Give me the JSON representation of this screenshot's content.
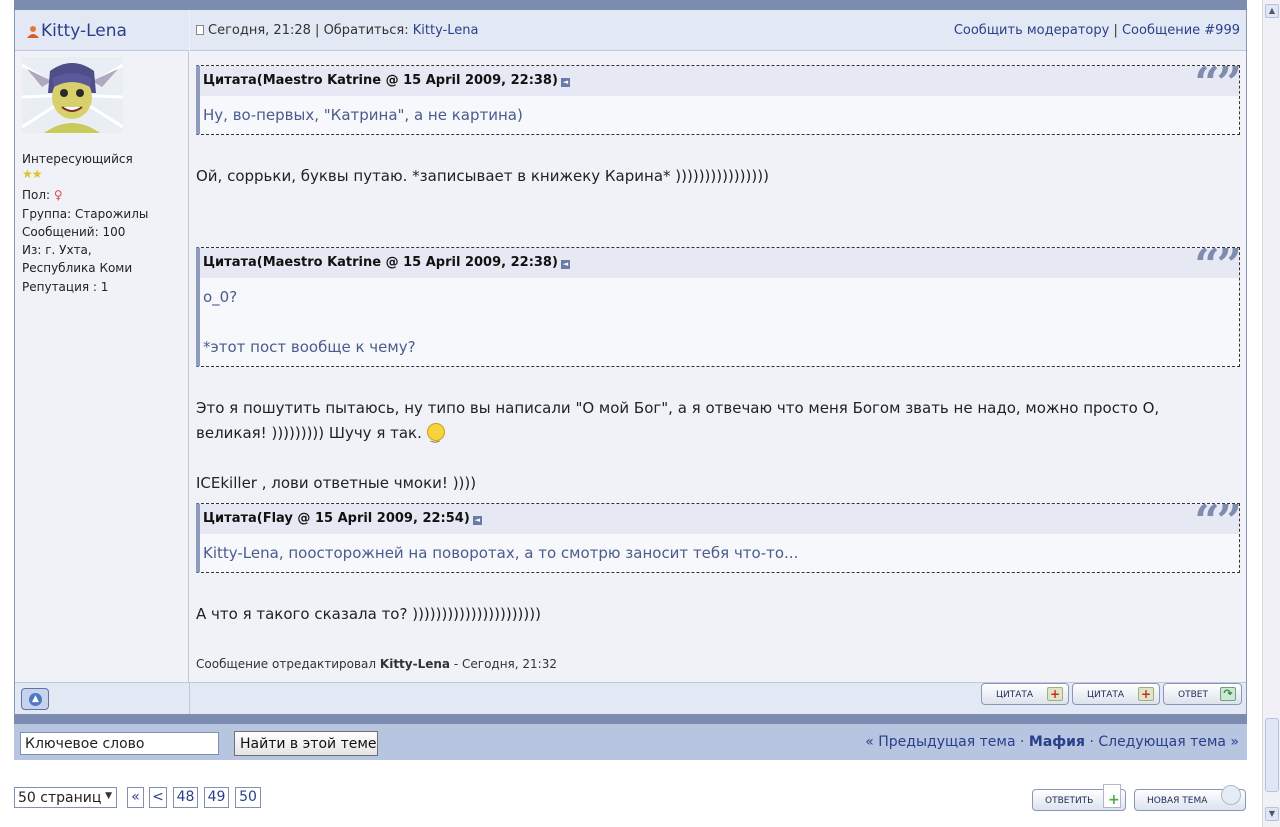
{
  "colors": {
    "accent": "#2a3f8a",
    "frame": "#7c8cb0",
    "header_bg": "#e3e9f4",
    "quote_text": "#4b5b8c"
  },
  "author": {
    "name": "Kitty-Lena",
    "title": "Интересующийся",
    "gender_label": "Пол:",
    "group": "Группа: Старожилы",
    "posts": "Сообщений: 100",
    "from_line1": "Из: г. Ухта,",
    "from_line2": "Республика Коми",
    "reputation": "Репутация : 1"
  },
  "post": {
    "date": "Сегодня, 21:28",
    "address_label": "Обратиться:",
    "address_name": "Kitty-Lena",
    "report_label": "Сообщить модератору",
    "message_label": "Сообщение #999",
    "quote1": {
      "header": "Цитата(Maestro Katrine @ 15 April 2009, 22:38)",
      "body": "Ну, во-первых, \"Катрина\", а не картина)"
    },
    "text1": "Ой, соррьки, буквы путаю. *записывает в книжеку Карина* ))))))))))))))))",
    "quote2": {
      "header": "Цитата(Maestro Katrine @ 15 April 2009, 22:38)",
      "line1": "о_0?",
      "line2": "*этот пост вообще к чему?"
    },
    "text2_line1": "Это я пошутить пытаюсь, ну типо вы написали \"О мой Бог\", а я отвечаю что меня Богом звать не надо, можно просто О,",
    "text2_line2": "великая! ))))))))) Шучу я так.",
    "text3": "ICEkiller , лови ответные чмоки! ))))",
    "quote3": {
      "header": "Цитата(Flay @ 15 April 2009, 22:54)",
      "body": "Kitty-Lena, поосторожней на поворотах, а то смотрю заносит тебя что-то..."
    },
    "text4": "А что я такого сказала то? ))))))))))))))))))))))",
    "edited_prefix": "Сообщение отредактировал",
    "edited_by": "Kitty-Lena",
    "edited_time": "- Сегодня, 21:32"
  },
  "buttons": {
    "quote1": "ЦИТАТА",
    "quote2": "ЦИТАТА",
    "reply": "ОТВЕТ",
    "reply_bottom": "ОТВЕТИТЬ",
    "new_topic": "НОВАЯ ТЕМА"
  },
  "search": {
    "keyword": "Ключевое слово",
    "button": "Найти в этой теме"
  },
  "topic_nav": {
    "prev": "« Предыдущая тема",
    "sep": "·",
    "current": "Мафия",
    "next": "Следующая тема »"
  },
  "pagination": {
    "pages_label": "50 страниц",
    "first": "«",
    "prev": "<",
    "pages": [
      "48",
      "49",
      "50"
    ]
  }
}
